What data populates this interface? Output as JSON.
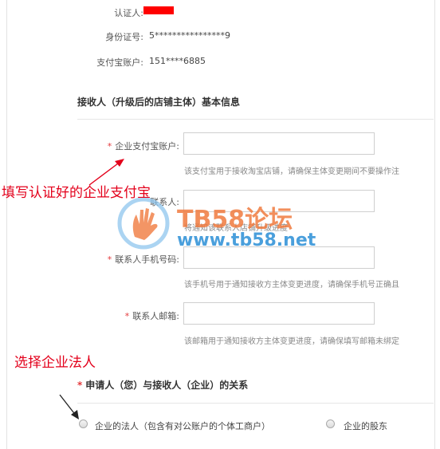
{
  "identity": {
    "certifier_label": "认证人:",
    "id_label": "身份证号:",
    "id_value": "5****************9",
    "alipay_label": "支付宝账户:",
    "alipay_value": "151****6885"
  },
  "receiver_section": {
    "title": "接收人（升级后的店铺主体）基本信息",
    "fields": {
      "enterprise_alipay": {
        "label": "企业支付宝账户:",
        "value": "",
        "hint": "该支付宝用于接收淘宝店铺，请确保主体变更期间不要操作注",
        "required": true
      },
      "contact": {
        "label": "联系人:",
        "value": "",
        "hint": "将通知该联系人店铺升级进度",
        "required": false
      },
      "contact_phone": {
        "label": "联系人手机号码:",
        "value": "",
        "hint": "该手机号用于通知接收方主体变更进度，请确保手机号正确且",
        "required": true
      },
      "contact_email": {
        "label": "联系人邮箱:",
        "value": "",
        "hint": "该邮箱用于通知接收方主体变更进度，请确保填写邮箱未绑定",
        "required": true
      }
    }
  },
  "relation_section": {
    "title": "申请人（您）与接收人（企业）的关系",
    "options": [
      "企业的法人（包含有对公账户的个体工商户）",
      "企业的股东"
    ]
  },
  "annotations": {
    "fill_enterprise_alipay": "填写认证好的企业支付宝",
    "choose_legal_person": "选择企业法人"
  },
  "watermark": {
    "brand": "TB58论坛",
    "url": "www.tb58.net"
  },
  "colors": {
    "required_star": "#e4393c",
    "annotation": "#e3001b",
    "watermark_orange": "#f07b3f",
    "watermark_blue": "#2b8fd6"
  }
}
